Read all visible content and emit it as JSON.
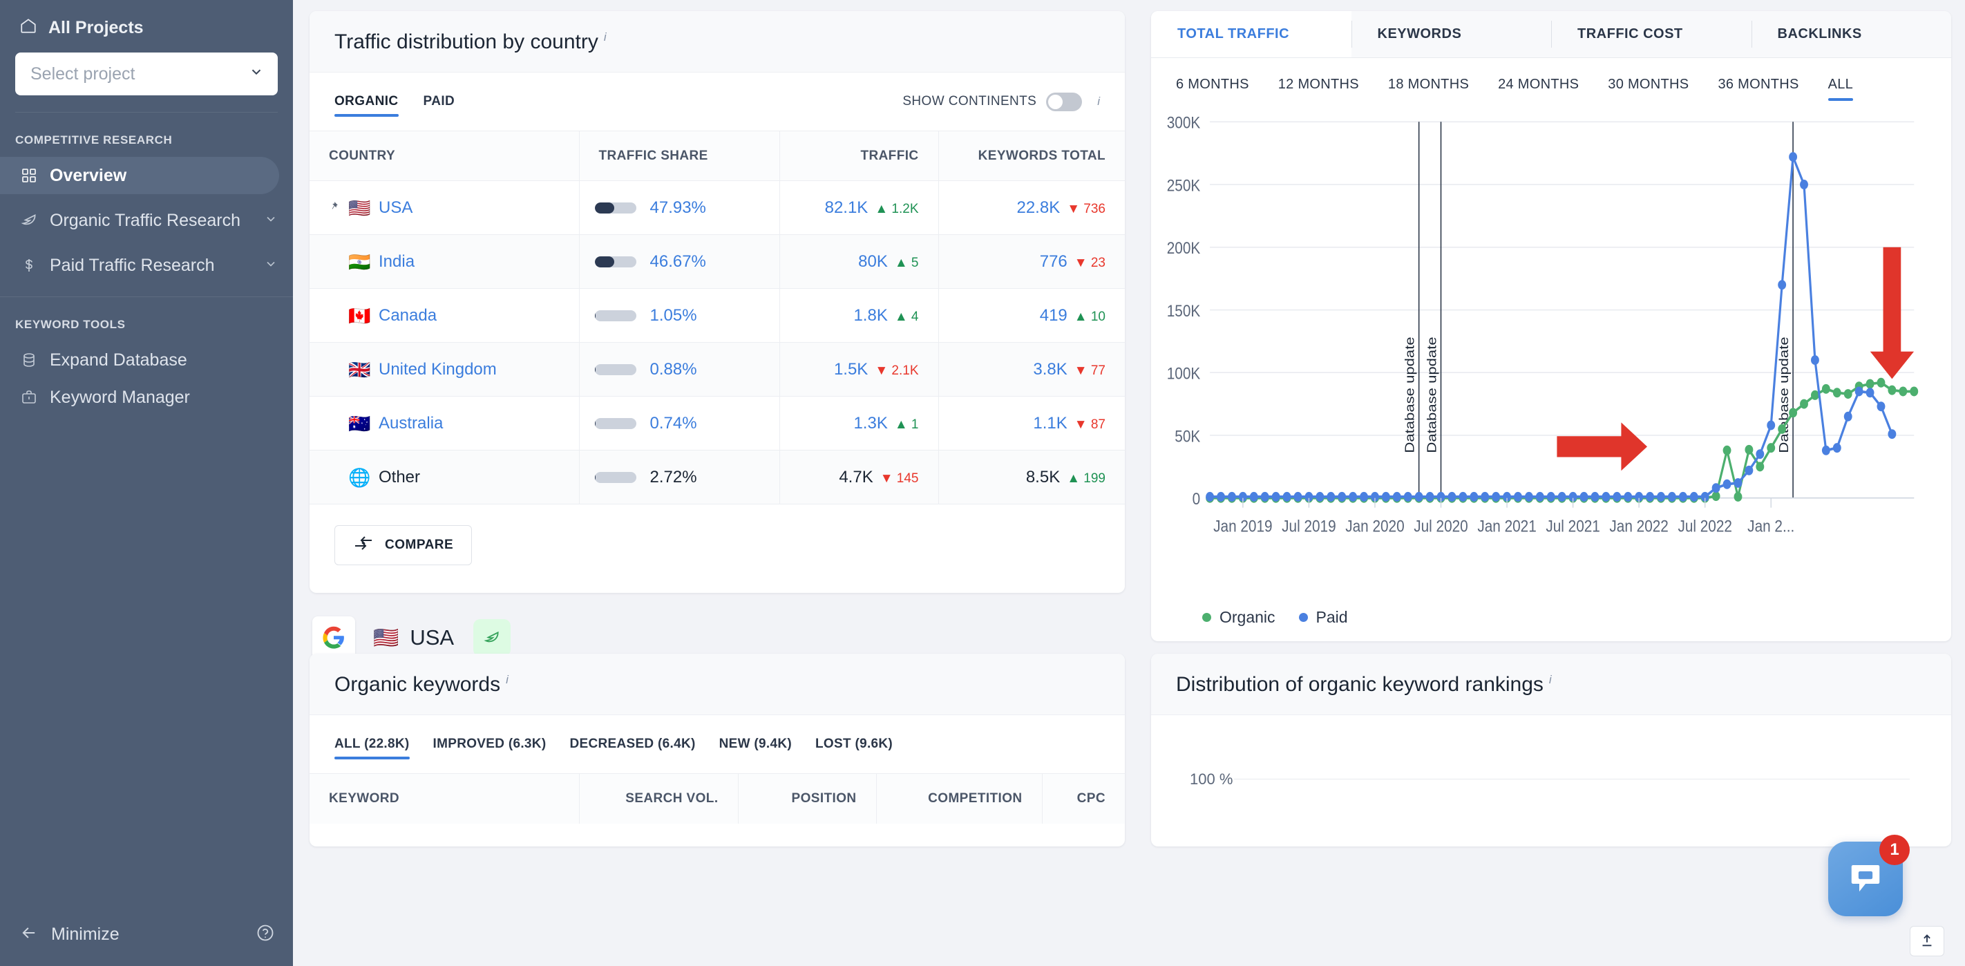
{
  "sidebar": {
    "all_projects": "All Projects",
    "project_select_placeholder": "Select project",
    "sections": [
      {
        "label": "COMPETITIVE RESEARCH",
        "items": [
          {
            "label": "Overview",
            "icon": "grid-icon",
            "active": true,
            "chevron": false
          },
          {
            "label": "Organic Traffic Research",
            "icon": "leaf-icon",
            "active": false,
            "chevron": true
          },
          {
            "label": "Paid Traffic Research",
            "icon": "dollar-icon",
            "active": false,
            "chevron": true
          }
        ]
      },
      {
        "label": "KEYWORD TOOLS",
        "items": [
          {
            "label": "Expand Database",
            "icon": "database-icon",
            "active": false,
            "chevron": false
          },
          {
            "label": "Keyword Manager",
            "icon": "briefcase-icon",
            "active": false,
            "chevron": false
          }
        ]
      }
    ],
    "minimize": "Minimize"
  },
  "traffic_card": {
    "title": "Traffic distribution by country",
    "info": "i",
    "tabs": [
      {
        "label": "ORGANIC",
        "active": true
      },
      {
        "label": "PAID",
        "active": false
      }
    ],
    "toggle_label": "SHOW CONTINENTS",
    "toggle_on": false,
    "columns": [
      "COUNTRY",
      "TRAFFIC SHARE",
      "TRAFFIC",
      "KEYWORDS TOTAL"
    ],
    "rows": [
      {
        "flag": "🇺🇸",
        "pinned": true,
        "country": "USA",
        "share": "47.93%",
        "share_pct": 47.93,
        "traffic": "82.1K",
        "traffic_delta": "1.2K",
        "traffic_dir": "up",
        "keywords": "22.8K",
        "kw_delta": "736",
        "kw_dir": "down",
        "other": false
      },
      {
        "flag": "🇮🇳",
        "pinned": false,
        "country": "India",
        "share": "46.67%",
        "share_pct": 46.67,
        "traffic": "80K",
        "traffic_delta": "5",
        "traffic_dir": "up",
        "keywords": "776",
        "kw_delta": "23",
        "kw_dir": "down",
        "other": false
      },
      {
        "flag": "🇨🇦",
        "pinned": false,
        "country": "Canada",
        "share": "1.05%",
        "share_pct": 1.05,
        "traffic": "1.8K",
        "traffic_delta": "4",
        "traffic_dir": "up",
        "keywords": "419",
        "kw_delta": "10",
        "kw_dir": "up",
        "other": false
      },
      {
        "flag": "🇬🇧",
        "pinned": false,
        "country": "United Kingdom",
        "share": "0.88%",
        "share_pct": 0.88,
        "traffic": "1.5K",
        "traffic_delta": "2.1K",
        "traffic_dir": "down",
        "keywords": "3.8K",
        "kw_delta": "77",
        "kw_dir": "down",
        "other": false
      },
      {
        "flag": "🇦🇺",
        "pinned": false,
        "country": "Australia",
        "share": "0.74%",
        "share_pct": 0.74,
        "traffic": "1.3K",
        "traffic_delta": "1",
        "traffic_dir": "up",
        "keywords": "1.1K",
        "kw_delta": "87",
        "kw_dir": "down",
        "other": false
      },
      {
        "flag": "🌐",
        "pinned": false,
        "country": "Other",
        "share": "2.72%",
        "share_pct": 2.72,
        "traffic": "4.7K",
        "traffic_delta": "145",
        "traffic_dir": "down",
        "keywords": "8.5K",
        "kw_delta": "199",
        "kw_dir": "up",
        "other": true
      }
    ],
    "compare_label": "COMPARE"
  },
  "engine_row": {
    "engine": "google-icon",
    "flag": "🇺🇸",
    "name": "USA",
    "badge": "leaf-icon"
  },
  "organic_keywords": {
    "title": "Organic keywords",
    "info": "i",
    "tabs": [
      {
        "label": "ALL (22.8K)",
        "active": true
      },
      {
        "label": "IMPROVED (6.3K)",
        "active": false
      },
      {
        "label": "DECREASED (6.4K)",
        "active": false
      },
      {
        "label": "NEW (9.4K)",
        "active": false
      },
      {
        "label": "LOST (9.6K)",
        "active": false
      }
    ],
    "columns": [
      "KEYWORD",
      "SEARCH VOL.",
      "POSITION",
      "COMPETITION",
      "CPC"
    ]
  },
  "traffic_chart_card": {
    "tabs": [
      {
        "label": "TOTAL TRAFFIC",
        "active": true
      },
      {
        "label": "KEYWORDS",
        "active": false
      },
      {
        "label": "TRAFFIC COST",
        "active": false
      },
      {
        "label": "BACKLINKS",
        "active": false
      }
    ],
    "periods": [
      {
        "label": "6 MONTHS",
        "active": false
      },
      {
        "label": "12 MONTHS",
        "active": false
      },
      {
        "label": "18 MONTHS",
        "active": false
      },
      {
        "label": "24 MONTHS",
        "active": false
      },
      {
        "label": "30 MONTHS",
        "active": false
      },
      {
        "label": "36 MONTHS",
        "active": false
      },
      {
        "label": "ALL",
        "active": true
      }
    ],
    "export_icon": "export-upload-icon"
  },
  "rankings_card": {
    "title": "Distribution of organic keyword rankings",
    "info": "i",
    "y_labels": [
      "100 %"
    ]
  },
  "chat": {
    "badge": "1",
    "icon": "chat-bubble-icon"
  },
  "colors": {
    "accent_blue": "#3b7ddd",
    "sidebar_bg": "#4e5d74",
    "page_bg": "#f2f3f7",
    "organic_green": "#4caf6e",
    "paid_blue": "#4a80e0",
    "up_green": "#1f9254",
    "down_red": "#e8372c",
    "annotation_red": "#e0352b"
  },
  "chart_data": {
    "type": "line",
    "title": "",
    "xlabel": "",
    "ylabel": "",
    "ylim": [
      0,
      300000
    ],
    "yticks": [
      0,
      50000,
      100000,
      150000,
      200000,
      250000,
      300000
    ],
    "ytick_labels": [
      "0",
      "50K",
      "100K",
      "150K",
      "200K",
      "250K",
      "300K"
    ],
    "grid": true,
    "legend_position": "bottom-left",
    "xtick_labels": [
      "Jan 2019",
      "Jul 2019",
      "Jan 2020",
      "Jul 2020",
      "Jan 2021",
      "Jul 2021",
      "Jan 2022",
      "Jul 2022",
      "Jan 2..."
    ],
    "annotations": [
      {
        "type": "vline",
        "label": "Database update",
        "x_index": 19
      },
      {
        "type": "vline",
        "label": "Database update",
        "x_index": 21
      },
      {
        "type": "vline",
        "label": "Database update",
        "x_index": 53
      },
      {
        "type": "arrow",
        "direction": "right",
        "color": "#e0352b",
        "note": "points at organic series rise near Jan 2022"
      },
      {
        "type": "arrow",
        "direction": "down",
        "color": "#e0352b",
        "note": "points at latest paid decline near Jan 2023"
      }
    ],
    "series": [
      {
        "name": "Organic",
        "color": "#4caf6e",
        "values": [
          0,
          0,
          0,
          0,
          0,
          0,
          0,
          0,
          0,
          0,
          0,
          0,
          0,
          0,
          0,
          0,
          0,
          0,
          0,
          0,
          0,
          0,
          0,
          0,
          0,
          0,
          0,
          0,
          0,
          0,
          0,
          0,
          0,
          0,
          0,
          0,
          0,
          0,
          0,
          0,
          0,
          0,
          0,
          0,
          0,
          0,
          1500,
          38000,
          1000,
          38500,
          25000,
          40000,
          55000,
          68000,
          75000,
          82000,
          87000,
          84000,
          83000,
          89000,
          91000,
          92000,
          86000,
          85000,
          85000
        ]
      },
      {
        "name": "Paid",
        "color": "#4a80e0",
        "values": [
          1000,
          1000,
          1000,
          1000,
          1000,
          1000,
          1000,
          1000,
          1000,
          1000,
          1000,
          1000,
          1000,
          1000,
          1000,
          1000,
          1000,
          1000,
          1000,
          1000,
          1000,
          1000,
          1000,
          1000,
          1000,
          1000,
          1000,
          1000,
          1000,
          1000,
          1000,
          1000,
          1000,
          1000,
          1000,
          1000,
          1000,
          1000,
          1000,
          1000,
          1000,
          1000,
          1000,
          1000,
          1000,
          1000,
          8000,
          11000,
          12000,
          22000,
          35000,
          58000,
          170000,
          272000,
          250000,
          110000,
          38000,
          40000,
          65000,
          85000,
          84000,
          73000,
          51000
        ]
      }
    ]
  }
}
